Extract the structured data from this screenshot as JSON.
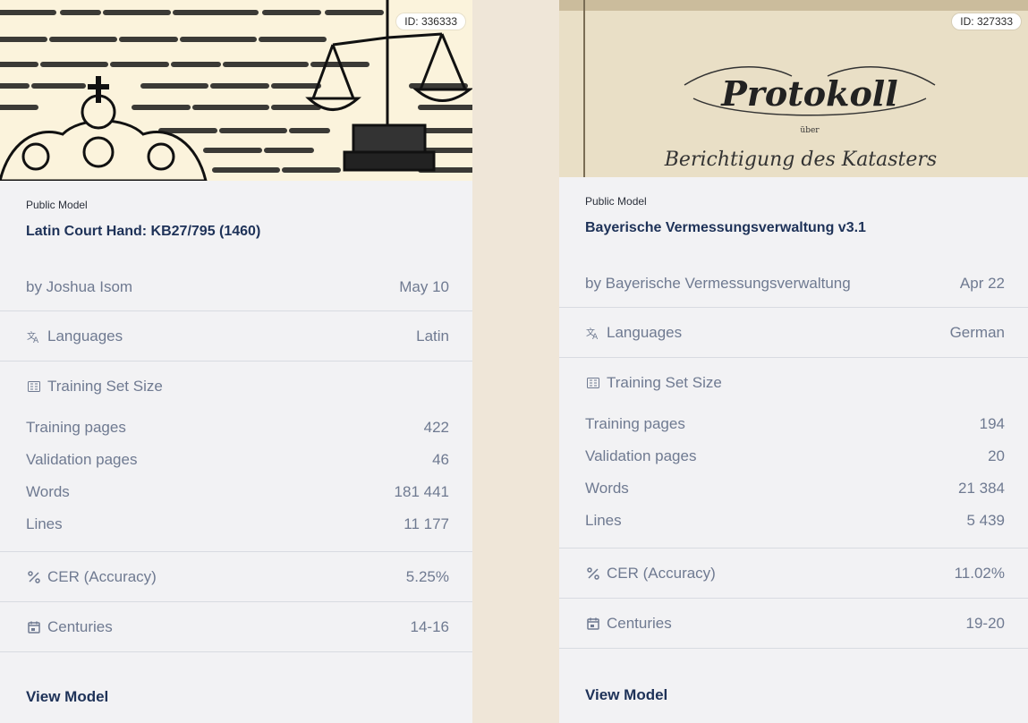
{
  "cards": [
    {
      "id_label": "ID: 336333",
      "visibility": "Public Model",
      "title": "Latin Court Hand: KB27/795 (1460)",
      "author": "by Joshua Isom",
      "date": "May 10",
      "languages_label": "Languages",
      "languages_value": "Latin",
      "training_set_label": "Training Set Size",
      "stats": [
        {
          "label": "Training pages",
          "value": "422"
        },
        {
          "label": "Validation pages",
          "value": "46"
        },
        {
          "label": "Words",
          "value": "181 441"
        },
        {
          "label": "Lines",
          "value": "11 177"
        }
      ],
      "cer_label": "CER (Accuracy)",
      "cer_value": "5.25%",
      "centuries_label": "Centuries",
      "centuries_value": "14-16",
      "view_label": "View Model"
    },
    {
      "id_label": "ID: 327333",
      "visibility": "Public Model",
      "title": "Bayerische Vermessungsverwaltung v3.1",
      "author": "by Bayerische Vermessungsverwaltung",
      "date": "Apr 22",
      "languages_label": "Languages",
      "languages_value": "German",
      "training_set_label": "Training Set Size",
      "stats": [
        {
          "label": "Training pages",
          "value": "194"
        },
        {
          "label": "Validation pages",
          "value": "20"
        },
        {
          "label": "Words",
          "value": "21 384"
        },
        {
          "label": "Lines",
          "value": "5 439"
        }
      ],
      "cer_label": "CER (Accuracy)",
      "cer_value": "11.02%",
      "centuries_label": "Centuries",
      "centuries_value": "19-20",
      "view_label": "View Model"
    }
  ],
  "thumb_text": {
    "protokoll": "Protokoll",
    "ueber": "über",
    "berichtigung": "Berichtigung des Katasters"
  },
  "colors": {
    "title": "#1e3258",
    "muted": "#6f7a91",
    "card_bg": "#f2f2f4",
    "page_bg": "#efe6d8"
  }
}
